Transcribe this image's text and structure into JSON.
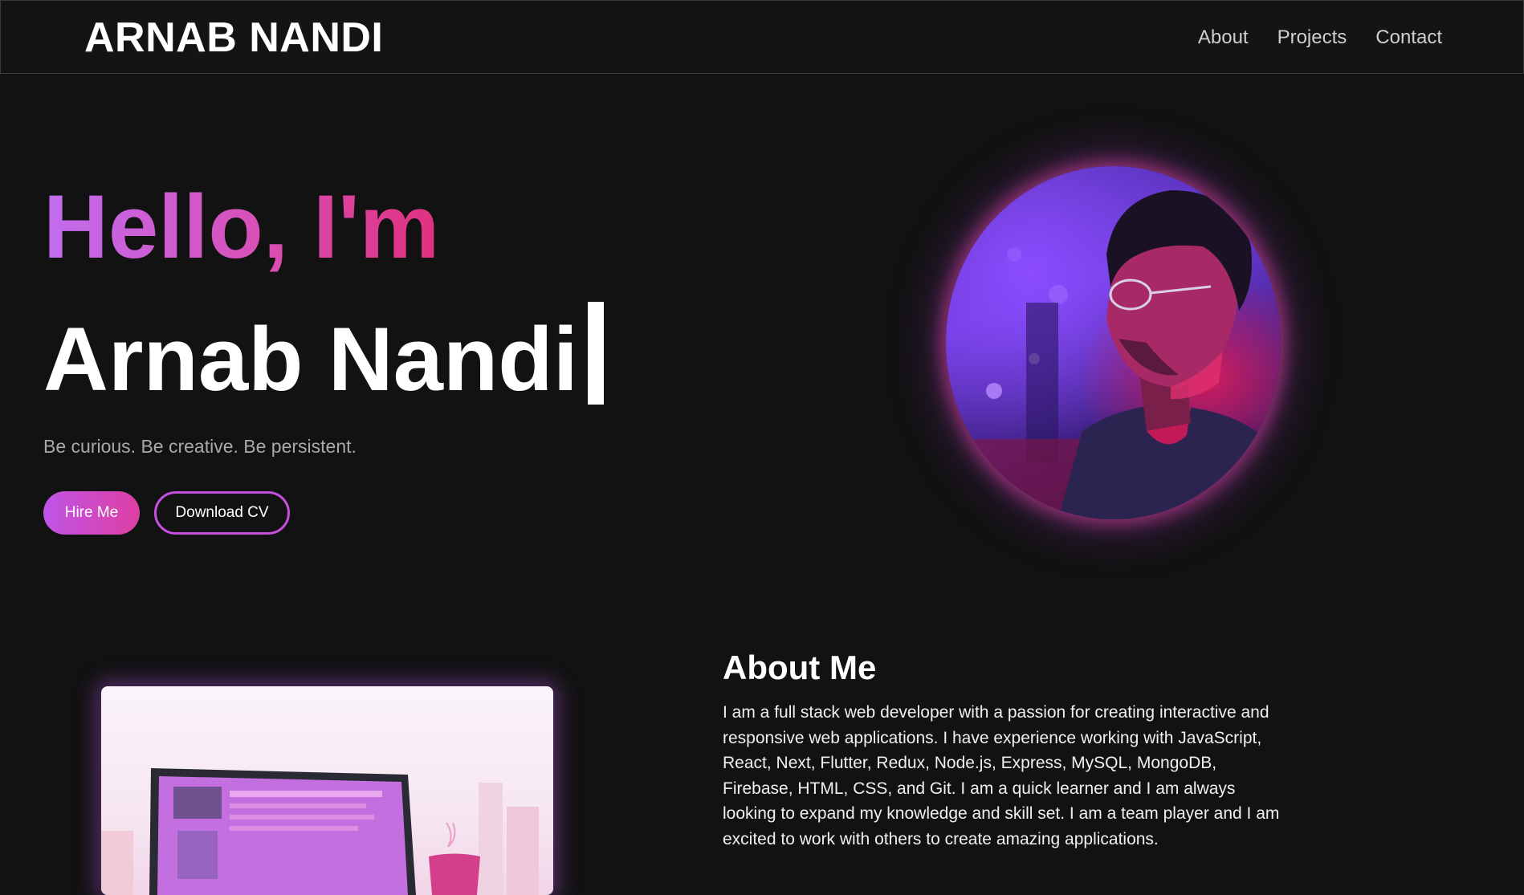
{
  "navbar": {
    "brand": "ARNAB NANDI",
    "links": [
      "About",
      "Projects",
      "Contact"
    ]
  },
  "hero": {
    "greeting": "Hello, I'm",
    "name": "Arnab Nandi",
    "tagline": "Be curious. Be creative. Be persistent.",
    "hire_label": "Hire Me",
    "cv_label": "Download CV"
  },
  "about": {
    "title": "About Me",
    "text": "I am a full stack web developer with a passion for creating interactive and responsive web applications. I have experience working with JavaScript, React, Next, Flutter, Redux, Node.js, Express, MySQL, MongoDB, Firebase, HTML, CSS, and Git. I am a quick learner and I am always looking to expand my knowledge and skill set. I am a team player and I am excited to work with others to create amazing applications."
  },
  "colors": {
    "background": "#121212",
    "accent_purple": "#c16df0",
    "accent_pink": "#e0317f"
  }
}
